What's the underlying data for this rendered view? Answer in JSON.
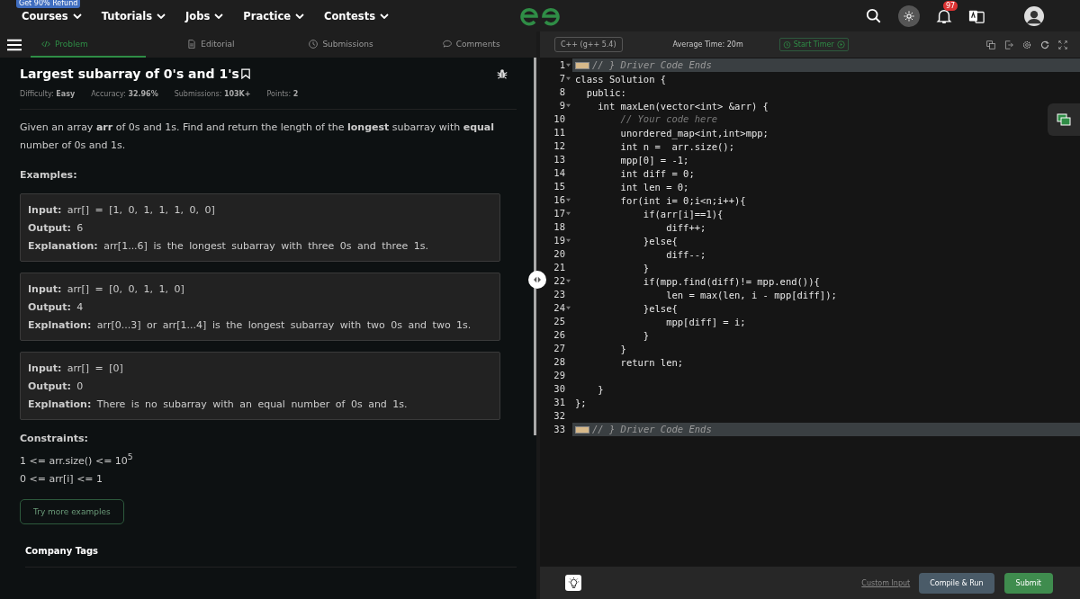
{
  "promo_badge": "Get 90% Refund",
  "nav": [
    {
      "label": "Courses"
    },
    {
      "label": "Tutorials"
    },
    {
      "label": "Jobs"
    },
    {
      "label": "Practice"
    },
    {
      "label": "Contests"
    }
  ],
  "notifications": {
    "count": "97"
  },
  "tabs": [
    {
      "label": "Problem",
      "selected": true,
      "kind": "code"
    },
    {
      "label": "Editorial",
      "selected": false,
      "kind": "doc"
    },
    {
      "label": "Submissions",
      "selected": false,
      "kind": "clock"
    },
    {
      "label": "Comments",
      "selected": false,
      "kind": "chat"
    }
  ],
  "problem": {
    "title": "Largest subarray of 0's and 1's",
    "meta": [
      {
        "label": "Difficulty:",
        "value": "Easy"
      },
      {
        "label": "Accuracy:",
        "value": "32.96%"
      },
      {
        "label": "Submissions:",
        "value": "103K+"
      },
      {
        "label": "Points:",
        "value": "2"
      }
    ],
    "description": "Given an array **arr** of 0s and 1s. Find and return the length of the **longest** subarray with **equal** number of 0s and 1s.",
    "examples_heading": "Examples:",
    "examples": [
      [
        {
          "label": "Input:",
          "value": "arr[] = [1, 0, 1, 1, 1, 0, 0]"
        },
        {
          "label": "Output:",
          "value": "6"
        },
        {
          "label": "Explanation:",
          "value": "arr[1...6] is the longest subarray with three 0s and three 1s."
        }
      ],
      [
        {
          "label": "Input:",
          "value": "arr[] = [0, 0, 1, 1, 0]"
        },
        {
          "label": "Output:",
          "value": "4"
        },
        {
          "label": "Explnation:",
          "value": "arr[0...3] or arr[1...4] is the longest subarray with two 0s and two 1s."
        }
      ],
      [
        {
          "label": "Input:",
          "value": "arr[] = [0]"
        },
        {
          "label": "Output:",
          "value": "0"
        },
        {
          "label": "Explnation:",
          "value": "There is no subarray with an equal number of 0s and 1s."
        }
      ]
    ],
    "constraints_heading": "Constraints:",
    "constraints": [
      "1 <= arr.size() <= 10$^{5}$",
      "0 <= arr[i] <= 1"
    ],
    "try_button": "Try more examples",
    "company_tags": "Company Tags"
  },
  "editor": {
    "language": "C++ (g++ 5.4)",
    "average_time": "Average Time: 20m",
    "timer_button": "Start Timer",
    "lines": [
      {
        "num": "1",
        "text": "// } Driver Code Ends",
        "kind": "folded",
        "foldable": true
      },
      {
        "num": "7",
        "text": "class Solution {",
        "kind": "code",
        "foldable": true
      },
      {
        "num": "8",
        "text": "  public:",
        "kind": "code",
        "foldable": false
      },
      {
        "num": "9",
        "text": "    int maxLen(vector<int> &arr) {",
        "kind": "code",
        "foldable": true
      },
      {
        "num": "10",
        "text": "        // Your code here",
        "kind": "comment",
        "foldable": false
      },
      {
        "num": "11",
        "text": "        unordered_map<int,int>mpp;",
        "kind": "code",
        "foldable": false
      },
      {
        "num": "12",
        "text": "        int n =  arr.size();",
        "kind": "code",
        "foldable": false
      },
      {
        "num": "13",
        "text": "        mpp[0] = -1;",
        "kind": "code",
        "foldable": false
      },
      {
        "num": "14",
        "text": "        int diff = 0;",
        "kind": "code",
        "foldable": false
      },
      {
        "num": "15",
        "text": "        int len = 0;",
        "kind": "code",
        "foldable": false
      },
      {
        "num": "16",
        "text": "        for(int i= 0;i<n;i++){",
        "kind": "code",
        "foldable": true
      },
      {
        "num": "17",
        "text": "            if(arr[i]==1){",
        "kind": "code",
        "foldable": true
      },
      {
        "num": "18",
        "text": "                diff++;",
        "kind": "code",
        "foldable": false
      },
      {
        "num": "19",
        "text": "            }else{",
        "kind": "code",
        "foldable": true
      },
      {
        "num": "20",
        "text": "                diff--;",
        "kind": "code",
        "foldable": false
      },
      {
        "num": "21",
        "text": "            }",
        "kind": "code",
        "foldable": false
      },
      {
        "num": "22",
        "text": "            if(mpp.find(diff)!= mpp.end()){",
        "kind": "code",
        "foldable": true
      },
      {
        "num": "23",
        "text": "                len = max(len, i - mpp[diff]);",
        "kind": "code",
        "foldable": false
      },
      {
        "num": "24",
        "text": "            }else{",
        "kind": "code",
        "foldable": true
      },
      {
        "num": "25",
        "text": "                mpp[diff] = i;",
        "kind": "code",
        "foldable": false
      },
      {
        "num": "26",
        "text": "            }",
        "kind": "code",
        "foldable": false
      },
      {
        "num": "27",
        "text": "        }",
        "kind": "code",
        "foldable": false
      },
      {
        "num": "28",
        "text": "        return len;",
        "kind": "code",
        "foldable": false
      },
      {
        "num": "29",
        "kind": "code",
        "foldable": false
      },
      {
        "num": "30",
        "text": "    }",
        "kind": "code",
        "foldable": false
      },
      {
        "num": "31",
        "text": "};",
        "kind": "code",
        "foldable": false
      },
      {
        "num": "32",
        "kind": "code",
        "foldable": false
      },
      {
        "num": "33",
        "text": "// } Driver Code Ends",
        "kind": "folded",
        "foldable": false
      }
    ],
    "custom_input": "Custom Input",
    "compile_button": "Compile & Run",
    "submit_button": "Submit"
  }
}
